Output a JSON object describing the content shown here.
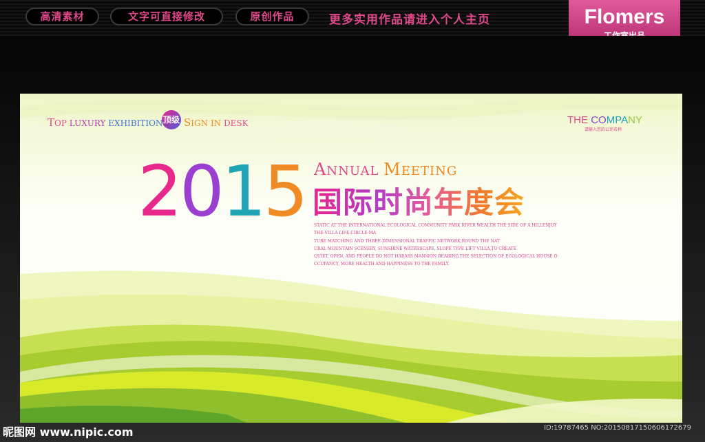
{
  "top_nav": {
    "pill_1": "高清素材",
    "pill_2": "文字可直接修改",
    "pill_3": "原创作品",
    "slogan": "更多实用作品请进入个人主页"
  },
  "brand": {
    "name": "Flomers",
    "subtitle": "工作室出品"
  },
  "poster": {
    "tagline": {
      "w1_cap": "T",
      "w1_rest": "OP",
      "w2": "LUXURY",
      "w3": "EXHIBITION",
      "badge": "顶级",
      "w4_cap": "S",
      "w4_rest": "IGN",
      "w5": "IN",
      "w6": "DESK"
    },
    "company": {
      "name": "THE COMPANY",
      "subtitle": "请输入您的公司名称"
    },
    "year": {
      "d1": "2",
      "d2": "0",
      "d3": "1",
      "d4": "5"
    },
    "annual": {
      "a_cap": "A",
      "a_rest": "NNUAL",
      "m_cap": "M",
      "m_rest": "EETING"
    },
    "title_cn": "国际时尚年度会",
    "paragraph": [
      "STATIC AT THE INTERNATIONAL ECOLOGICAL COMMUNITY PARK RIVER WEALTH THE SIDE OF A HILLENJOY",
      "THE VILLA LIFE.CIRCLE MA",
      "TURE MATCHING AND THREE-DIMENSIONAL TRAFFIC NETWORK,ROUND THE NAT",
      "URAL MOUNTAIN SCENERY, SUNSHINE WATERSCAPE, SLOPE TYPE LIFT VILLA,TO CREATE",
      "QUIET, OPEN, AND PEOPLE DO NOT HARASS MANSION BEARING,THE SELECTION OF ECOLOGICAL HOUSE O",
      "CCUPANCY, MORE HEALTH AND HAPPINESS TO THE FAMILY."
    ]
  },
  "watermark": {
    "site": "昵图网 www.nipic.com",
    "id": "ID:19787465 NO:20150817150606172679"
  },
  "colors": {
    "pink": "#e0488c",
    "purple": "#8a3fd0",
    "teal": "#1fa3b5",
    "lime": "#9cc93a",
    "orange": "#f08a24"
  }
}
